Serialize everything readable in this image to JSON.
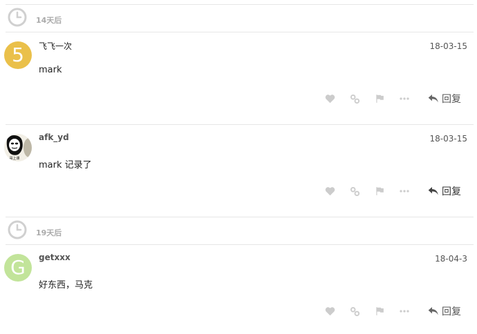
{
  "gaps": [
    {
      "text": "14天后"
    },
    {
      "text": "19天后"
    }
  ],
  "posts": [
    {
      "username": "飞飞一次",
      "date": "18-03-15",
      "body": "mark",
      "avatar_letter": "5",
      "avatar_color": "#eac04a"
    },
    {
      "username": "afk_yd",
      "date": "18-03-15",
      "body": "mark 记录了",
      "avatar_caption": "哥上课"
    },
    {
      "username": "getxxx",
      "date": "18-04-3",
      "body": "好东西，马克",
      "avatar_letter": "G",
      "avatar_color": "#c2e49a"
    }
  ],
  "actions": {
    "reply_label": "回复",
    "icons": [
      "heart-icon",
      "link-icon",
      "flag-icon",
      "more-icon",
      "reply-icon"
    ]
  },
  "colors": {
    "icon_gray": "#cccccc",
    "reply_gray": "#555555",
    "divider": "#e6e6e6"
  }
}
